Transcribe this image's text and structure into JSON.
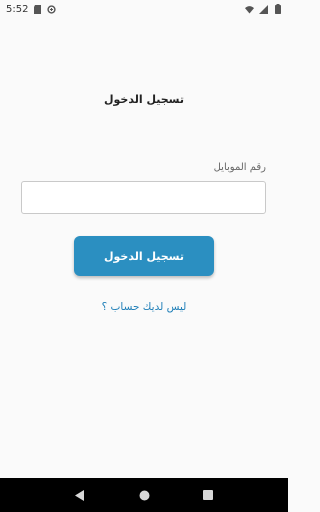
{
  "status_bar": {
    "time": "5:52",
    "left_icons": [
      "sd-card-icon",
      "data-saver-icon"
    ],
    "right_icons": [
      "wifi-icon",
      "signal-icon",
      "battery-icon"
    ]
  },
  "login": {
    "title": "تسجيل الدخول",
    "mobile_label": "رقم الموبايل",
    "mobile_value": "",
    "mobile_placeholder": "",
    "button_label": "تسجيل الدخول",
    "signup_link": "ليس لديك حساب ؟"
  },
  "colors": {
    "accent": "#2b8fc1",
    "link": "#1f7fb8",
    "background": "#fafafa"
  },
  "nav_bar": {
    "buttons": [
      "back-icon",
      "home-icon",
      "recents-icon"
    ]
  }
}
